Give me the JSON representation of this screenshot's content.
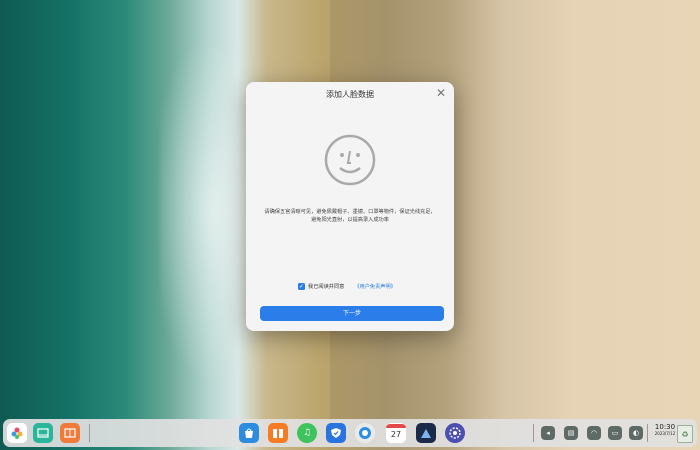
{
  "dialog": {
    "title": "添加人脸数据",
    "close_icon": "close-icon",
    "face_icon": "smiley-face-icon",
    "hint_line1": "请确保五官清晰可见，避免佩戴帽子、墨镜、口罩等物件，保证光线充足，",
    "hint_line2": "避免阳光直射，以提高录入成功率",
    "agree_text": "我已阅读并同意",
    "agree_link": "《用户免责声明》",
    "agree_checked": true,
    "next_label": "下一步",
    "accent_color": "#2b7de9"
  },
  "dock": {
    "left_apps": [
      {
        "name": "launcher-icon",
        "color": "#ffffff"
      },
      {
        "name": "multitask-view-icon",
        "color": "#2bb59a"
      },
      {
        "name": "workspace-icon",
        "color": "#f07a3a"
      }
    ],
    "center_apps": [
      {
        "name": "app-store-icon",
        "color": "#2b8ce0"
      },
      {
        "name": "archive-manager-icon",
        "color": "#f57c22"
      },
      {
        "name": "music-icon",
        "color": "#3ec35e"
      },
      {
        "name": "security-center-icon",
        "color": "#2a74e0"
      },
      {
        "name": "browser-icon",
        "color": "#eaeaea"
      },
      {
        "name": "calendar-icon",
        "color": "#ffffff"
      },
      {
        "name": "image-viewer-icon",
        "color": "#1c2a4a"
      },
      {
        "name": "control-center-icon",
        "color": "#4b4fb0"
      }
    ],
    "calendar_day": "27",
    "tray": [
      {
        "name": "volume-icon"
      },
      {
        "name": "keyboard-icon"
      },
      {
        "name": "wifi-icon"
      },
      {
        "name": "battery-icon"
      },
      {
        "name": "notification-icon"
      }
    ],
    "clock_time": "10:30",
    "clock_date": "2023/7/12",
    "trash_icon": "trash-icon"
  }
}
